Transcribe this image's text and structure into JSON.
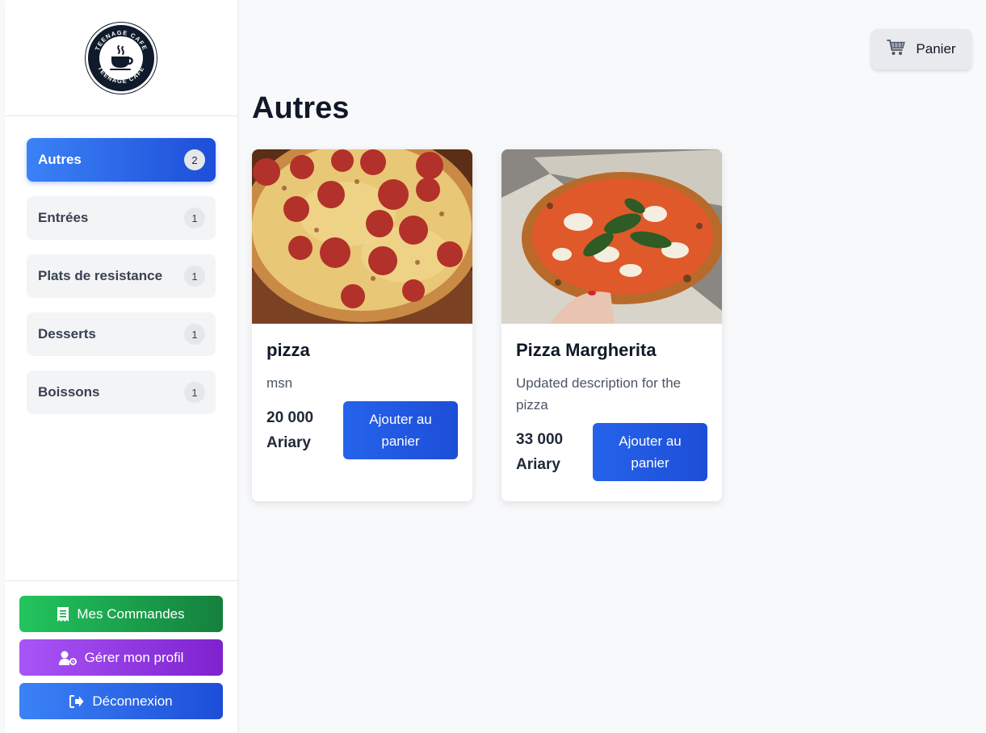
{
  "logo": {
    "text_top": "TEENAGE CAFE",
    "text_bottom": "TEENAGE CAFE"
  },
  "sidebar": {
    "items": [
      {
        "label": "Autres",
        "count": "2",
        "active": true
      },
      {
        "label": "Entrées",
        "count": "1",
        "active": false
      },
      {
        "label": "Plats de resistance",
        "count": "1",
        "active": false
      },
      {
        "label": "Desserts",
        "count": "1",
        "active": false
      },
      {
        "label": "Boissons",
        "count": "1",
        "active": false
      }
    ],
    "actions": {
      "orders_label": "Mes Commandes",
      "profile_label": "Gérer mon profil",
      "logout_label": "Déconnexion"
    }
  },
  "header": {
    "cart_label": "Panier"
  },
  "main": {
    "title": "Autres",
    "products": [
      {
        "name": "pizza",
        "description": "msn",
        "price": "20 000 Ariary",
        "button": "Ajouter au panier",
        "image": "pepperoni-pizza"
      },
      {
        "name": "Pizza Margherita",
        "description": "Updated description for the pizza",
        "price": "33 000 Ariary",
        "button": "Ajouter au panier",
        "image": "margherita-pizza-in-box"
      }
    ]
  },
  "colors": {
    "accent": "#2563eb",
    "green": "#16a34a",
    "purple": "#9333ea",
    "background": "#f8f9fb"
  }
}
